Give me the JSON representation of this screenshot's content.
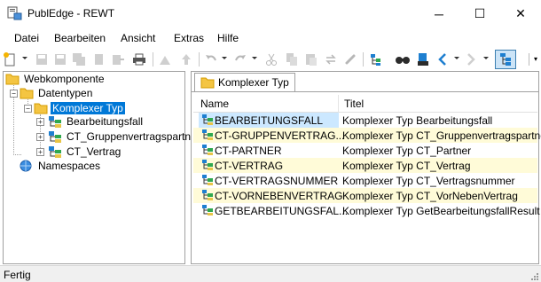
{
  "window": {
    "title": "PublEdge - REWT",
    "minimize_glyph": "─",
    "maximize_glyph": "☐",
    "close_glyph": "✕"
  },
  "menu": {
    "items": [
      {
        "label": "Datei"
      },
      {
        "label": "Bearbeiten"
      },
      {
        "label": "Ansicht"
      },
      {
        "label": "Extras"
      },
      {
        "label": "Hilfe"
      }
    ]
  },
  "toolbar": {
    "icons": [
      "new-icon",
      "save-icon",
      "save-as-icon",
      "save-all-icon",
      "copy-doc-icon",
      "export-icon",
      "print-icon",
      "import-icon",
      "upload-icon",
      "undo-icon",
      "redo-icon",
      "cut-icon",
      "copy-icon",
      "paste-icon",
      "replace-icon",
      "link-icon",
      "tree-view-icon",
      "find-icon",
      "bookmark-icon",
      "back-icon",
      "forward-icon",
      "structure-view-icon"
    ],
    "more_glyph": "▾"
  },
  "tree": {
    "root": {
      "label": "Webkomponente"
    },
    "datatypes": {
      "label": "Datentypen"
    },
    "complex_type": {
      "label": "Komplexer Typ"
    },
    "children": [
      {
        "label": "Bearbeitungsfall"
      },
      {
        "label": "CT_Gruppenvertragspartner"
      },
      {
        "label": "CT_Vertrag"
      }
    ],
    "namespaces": {
      "label": "Namespaces"
    },
    "expand_glyph": "+",
    "collapse_glyph": "−"
  },
  "tab": {
    "label": "Komplexer Typ"
  },
  "grid": {
    "headers": {
      "name": "Name",
      "title": "Titel"
    },
    "rows": [
      {
        "name": "BEARBEITUNGSFALL",
        "title": "Komplexer Typ Bearbeitungsfall"
      },
      {
        "name": "CT-GRUPPENVERTRAG...",
        "title": "Komplexer Typ CT_Gruppenvertragspartner"
      },
      {
        "name": "CT-PARTNER",
        "title": "Komplexer Typ CT_Partner"
      },
      {
        "name": "CT-VERTRAG",
        "title": "Komplexer Typ CT_Vertrag"
      },
      {
        "name": "CT-VERTRAGSNUMMER",
        "title": "Komplexer Typ CT_Vertragsnummer"
      },
      {
        "name": "CT-VORNEBENVERTRAG",
        "title": "Komplexer Typ CT_VorNebenVertrag"
      },
      {
        "name": "GETBEARBEITUNGSFAL...",
        "title": "Komplexer Typ GetBearbeitungsfallResult"
      }
    ]
  },
  "status": {
    "text": "Fertig"
  },
  "colors": {
    "selection": "#0078d7",
    "row_highlight": "#fffbd8",
    "row_selected": "#cce8ff",
    "folder": "#f4c542"
  }
}
